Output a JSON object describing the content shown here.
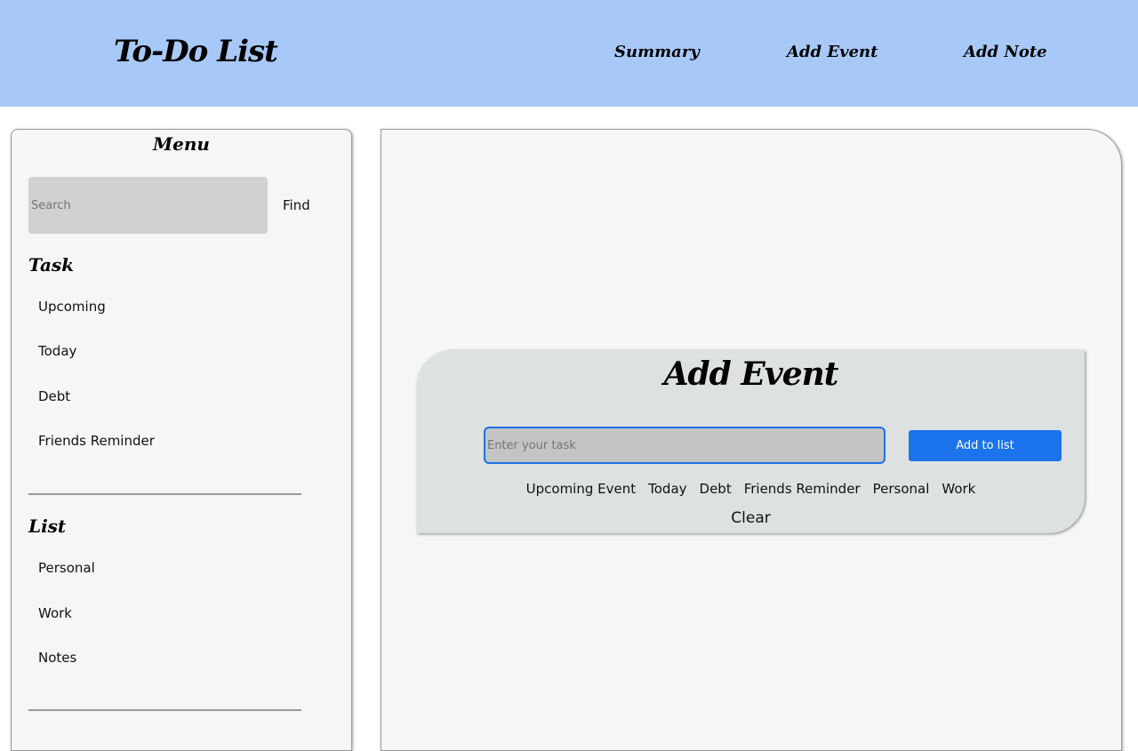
{
  "header": {
    "brand": "To-Do List",
    "nav": {
      "summary": "Summary",
      "add_event": "Add Event",
      "add_note": "Add Note"
    }
  },
  "sidebar": {
    "title": "Menu",
    "search": {
      "placeholder": "Search",
      "button": "Find"
    },
    "task_section": {
      "title": "Task",
      "items": [
        "Upcoming",
        "Today",
        "Debt",
        "Friends Reminder"
      ]
    },
    "list_section": {
      "title": "List",
      "items": [
        "Personal",
        "Work",
        "Notes"
      ]
    }
  },
  "event_form": {
    "title": "Add Event",
    "input_placeholder": "Enter your task",
    "add_button": "Add to list",
    "categories": [
      "Upcoming Event",
      "Today",
      "Debt",
      "Friends Reminder",
      "Personal",
      "Work"
    ],
    "clear_button": "Clear"
  },
  "colors": {
    "header_bg": "#a8c9f8",
    "panel_bg": "#f5f7f6",
    "card_bg": "#dee1e1",
    "accent": "#1b74eb"
  }
}
